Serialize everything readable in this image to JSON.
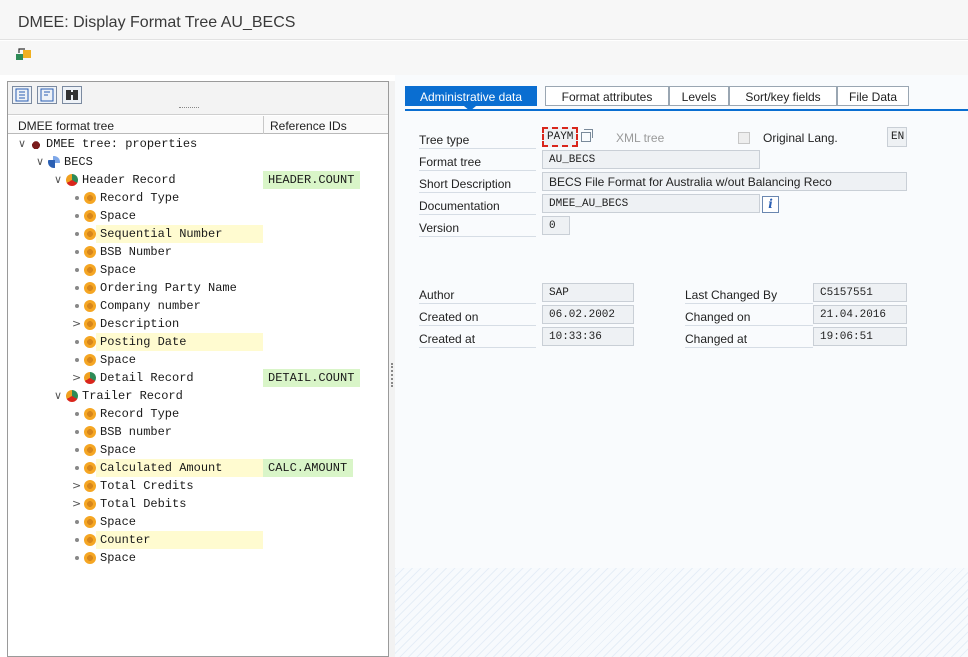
{
  "window": {
    "title": "DMEE: Display Format Tree AU_BECS"
  },
  "toolbar": {
    "icons": [
      "display-change-icon"
    ]
  },
  "left_pane": {
    "tool_icons": [
      "expand-all-icon",
      "collapse-all-icon",
      "find-icon"
    ],
    "columns": {
      "tree": "DMEE format tree",
      "refs": "Reference IDs"
    },
    "rows": [
      {
        "label": "DMEE tree: properties",
        "ref": "",
        "level": 0,
        "arrow": "∨",
        "icon": "tree",
        "hl": false
      },
      {
        "label": "BECS",
        "ref": "",
        "level": 1,
        "arrow": "∨",
        "icon": "becs",
        "hl": false
      },
      {
        "label": "Header Record",
        "ref": "HEADER.COUNT",
        "level": 2,
        "arrow": "∨",
        "icon": "record",
        "hl": false
      },
      {
        "label": "Record Type",
        "ref": "",
        "level": 3,
        "arrow": "",
        "icon": "field",
        "hl": false
      },
      {
        "label": "Space",
        "ref": "",
        "level": 3,
        "arrow": "",
        "icon": "field",
        "hl": false
      },
      {
        "label": "Sequential Number",
        "ref": "",
        "level": 3,
        "arrow": "",
        "icon": "field",
        "hl": true
      },
      {
        "label": "BSB Number",
        "ref": "",
        "level": 3,
        "arrow": "",
        "icon": "field",
        "hl": false
      },
      {
        "label": "Space",
        "ref": "",
        "level": 3,
        "arrow": "",
        "icon": "field",
        "hl": false
      },
      {
        "label": "Ordering Party Name",
        "ref": "",
        "level": 3,
        "arrow": "",
        "icon": "field",
        "hl": false
      },
      {
        "label": "Company number",
        "ref": "",
        "level": 3,
        "arrow": "",
        "icon": "field",
        "hl": false
      },
      {
        "label": "Description",
        "ref": "",
        "level": 3,
        "arrow": ">",
        "icon": "field",
        "hl": false
      },
      {
        "label": "Posting Date",
        "ref": "",
        "level": 3,
        "arrow": "",
        "icon": "field",
        "hl": true
      },
      {
        "label": "Space",
        "ref": "",
        "level": 3,
        "arrow": "",
        "icon": "field",
        "hl": false
      },
      {
        "label": "Detail Record",
        "ref": "DETAIL.COUNT",
        "level": 3,
        "arrow": ">",
        "icon": "record",
        "hl": false
      },
      {
        "label": "Trailer Record",
        "ref": "",
        "level": 2,
        "arrow": "∨",
        "icon": "record",
        "hl": false
      },
      {
        "label": "Record Type",
        "ref": "",
        "level": 3,
        "arrow": "",
        "icon": "field",
        "hl": false
      },
      {
        "label": "BSB number",
        "ref": "",
        "level": 3,
        "arrow": "",
        "icon": "field",
        "hl": false
      },
      {
        "label": "Space",
        "ref": "",
        "level": 3,
        "arrow": "",
        "icon": "field",
        "hl": false
      },
      {
        "label": "Calculated Amount",
        "ref": "CALC.AMOUNT",
        "level": 3,
        "arrow": "",
        "icon": "field",
        "hl": true
      },
      {
        "label": "Total Credits",
        "ref": "",
        "level": 3,
        "arrow": ">",
        "icon": "field",
        "hl": false
      },
      {
        "label": "Total Debits",
        "ref": "",
        "level": 3,
        "arrow": ">",
        "icon": "field",
        "hl": false
      },
      {
        "label": "Space",
        "ref": "",
        "level": 3,
        "arrow": "",
        "icon": "field",
        "hl": false
      },
      {
        "label": "Counter",
        "ref": "",
        "level": 3,
        "arrow": "",
        "icon": "field",
        "hl": true
      },
      {
        "label": "Space",
        "ref": "",
        "level": 3,
        "arrow": "",
        "icon": "field",
        "hl": false
      }
    ]
  },
  "tabs": [
    {
      "label": "Administrative data",
      "active": true
    },
    {
      "label": "Format attributes",
      "active": false
    },
    {
      "label": "Levels",
      "active": false
    },
    {
      "label": "Sort/key fields",
      "active": false
    },
    {
      "label": "File Data",
      "active": false
    }
  ],
  "admin": {
    "tree_type_label": "Tree type",
    "tree_type_value": "PAYM",
    "xml_tree_label": "XML tree",
    "original_lang_label": "Original Lang.",
    "original_lang_value": "EN",
    "format_tree_label": "Format tree",
    "format_tree_value": "AU_BECS",
    "short_desc_label": "Short Description",
    "short_desc_value": "BECS File Format for Australia w/out Balancing Reco",
    "documentation_label": "Documentation",
    "documentation_value": "DMEE_AU_BECS",
    "version_label": "Version",
    "version_value": "0",
    "author_label": "Author",
    "author_value": "SAP",
    "created_on_label": "Created on",
    "created_on_value": "06.02.2002",
    "created_at_label": "Created at",
    "created_at_value": "10:33:36",
    "last_changed_by_label": "Last Changed By",
    "last_changed_by_value": "C5157551",
    "changed_on_label": "Changed on",
    "changed_on_value": "21.04.2016",
    "changed_at_label": "Changed at",
    "changed_at_value": "19:06:51"
  }
}
